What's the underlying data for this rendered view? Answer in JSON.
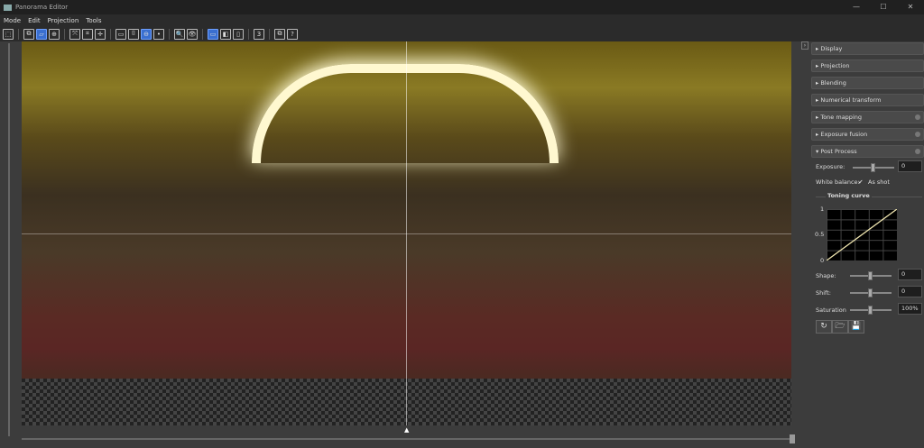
{
  "window": {
    "title": "Panorama Editor",
    "min": "—",
    "max": "☐",
    "close": "✕"
  },
  "menu": [
    "Mode",
    "Edit",
    "Projection",
    "Tools"
  ],
  "toolbar": [
    {
      "icon": "select-icon",
      "glyph": "⬚"
    },
    {
      "sep": true
    },
    {
      "icon": "images-icon",
      "glyph": "⧉"
    },
    {
      "icon": "panorama-icon",
      "glyph": "▱",
      "on": true
    },
    {
      "icon": "crosshair-icon",
      "glyph": "⊕"
    },
    {
      "sep": true
    },
    {
      "icon": "fit-icon",
      "glyph": "⤧"
    },
    {
      "icon": "fit-center-icon",
      "glyph": "⌗"
    },
    {
      "icon": "move-icon",
      "glyph": "✛"
    },
    {
      "sep": true
    },
    {
      "icon": "rectilinear-icon",
      "glyph": "▭"
    },
    {
      "icon": "cylindrical-icon",
      "glyph": "⌷"
    },
    {
      "icon": "spherical-icon",
      "glyph": "⊖",
      "on": true
    },
    {
      "icon": "more-icon",
      "glyph": "•"
    },
    {
      "sep": true
    },
    {
      "icon": "zoom-icon",
      "glyph": "🔍"
    },
    {
      "icon": "preview-eye-icon",
      "glyph": "👁"
    },
    {
      "sep": true
    },
    {
      "icon": "view-single-icon",
      "glyph": "▭",
      "on": true
    },
    {
      "icon": "view-split-icon",
      "glyph": "◧"
    },
    {
      "icon": "view-book-icon",
      "glyph": "▯"
    },
    {
      "sep": true
    },
    {
      "icon": "stack-icon",
      "glyph": "3"
    },
    {
      "sep": true
    },
    {
      "icon": "export-icon",
      "glyph": "⧉"
    },
    {
      "icon": "help-icon",
      "glyph": "?"
    }
  ],
  "panel": {
    "collapse": "›",
    "sections": [
      {
        "label": "Display",
        "dot": false
      },
      {
        "label": "Projection",
        "dot": false
      },
      {
        "label": "Blending",
        "dot": false
      },
      {
        "label": "Numerical transform",
        "dot": false
      },
      {
        "label": "Tone mapping",
        "dot": true
      },
      {
        "label": "Exposure fusion",
        "dot": true
      },
      {
        "label": "Post Process",
        "dot": true,
        "open": true
      }
    ],
    "exposure_label": "Exposure:",
    "exposure_value": "0",
    "white_balance_label": "White balance:",
    "white_balance_check": "✔",
    "white_balance_value": "As shot",
    "toning_curve_title": "Toning curve",
    "curve_ticks": [
      "1",
      "0.5",
      "0"
    ],
    "shape_label": "Shape:",
    "shape_value": "0",
    "shift_label": "Shift:",
    "shift_value": "0",
    "saturation_label": "Saturation",
    "saturation_value": "100%",
    "buttons": [
      {
        "icon": "reset-icon",
        "glyph": "↻"
      },
      {
        "icon": "open-folder-icon",
        "glyph": "🗁"
      },
      {
        "icon": "save-icon",
        "glyph": "💾"
      }
    ]
  },
  "canvas": {
    "bottom_marker": "▲"
  }
}
